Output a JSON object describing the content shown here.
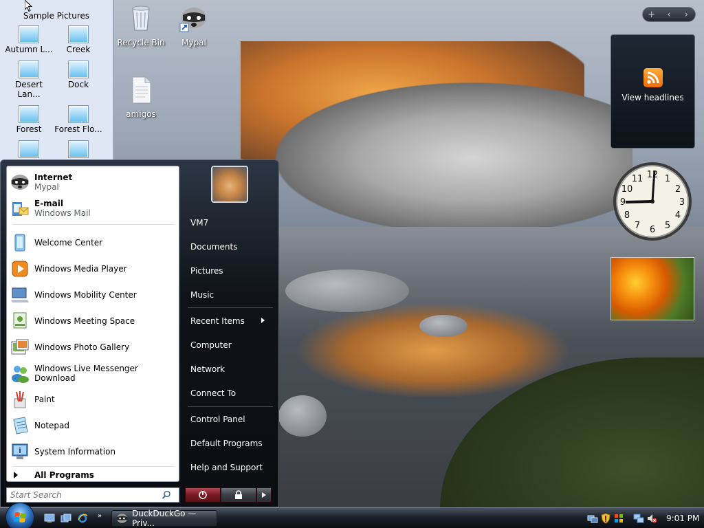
{
  "explorer": {
    "title": "Sample Pictures",
    "thumbnails": [
      "Autumn L...",
      "Creek",
      "Desert Lan...",
      "Dock",
      "Forest",
      "Forest Flo...",
      "",
      ""
    ]
  },
  "desktop_icons": [
    {
      "label": "Recycle Bin",
      "icon": "recycle-bin-icon"
    },
    {
      "label": "Mypal",
      "icon": "raccoon-icon"
    },
    {
      "label": "amigos",
      "icon": "document-icon"
    }
  ],
  "sidebar": {
    "feed_gadget_label": "View headlines",
    "clock_numbers": [
      "12",
      "1",
      "2",
      "3",
      "4",
      "5",
      "6",
      "7",
      "8",
      "9",
      "10",
      "11"
    ]
  },
  "start_menu": {
    "pinned": [
      {
        "title": "Internet",
        "subtitle": "Mypal"
      },
      {
        "title": "E-mail",
        "subtitle": "Windows Mail"
      }
    ],
    "recent": [
      "Welcome Center",
      "Windows Media Player",
      "Windows Mobility Center",
      "Windows Meeting Space",
      "Windows Photo Gallery",
      "Windows Live Messenger Download",
      "Paint",
      "Notepad",
      "System Information"
    ],
    "all_programs": "All Programs",
    "search_placeholder": "Start Search",
    "right_links": {
      "user": "VM7",
      "documents": "Documents",
      "pictures": "Pictures",
      "music": "Music",
      "recent_items": "Recent Items",
      "computer": "Computer",
      "network": "Network",
      "connect_to": "Connect To",
      "control_panel": "Control Panel",
      "default_programs": "Default Programs",
      "help": "Help and Support"
    }
  },
  "taskbar": {
    "task_label": "DuckDuckGo — Priv...",
    "clock": "9:01 PM"
  }
}
